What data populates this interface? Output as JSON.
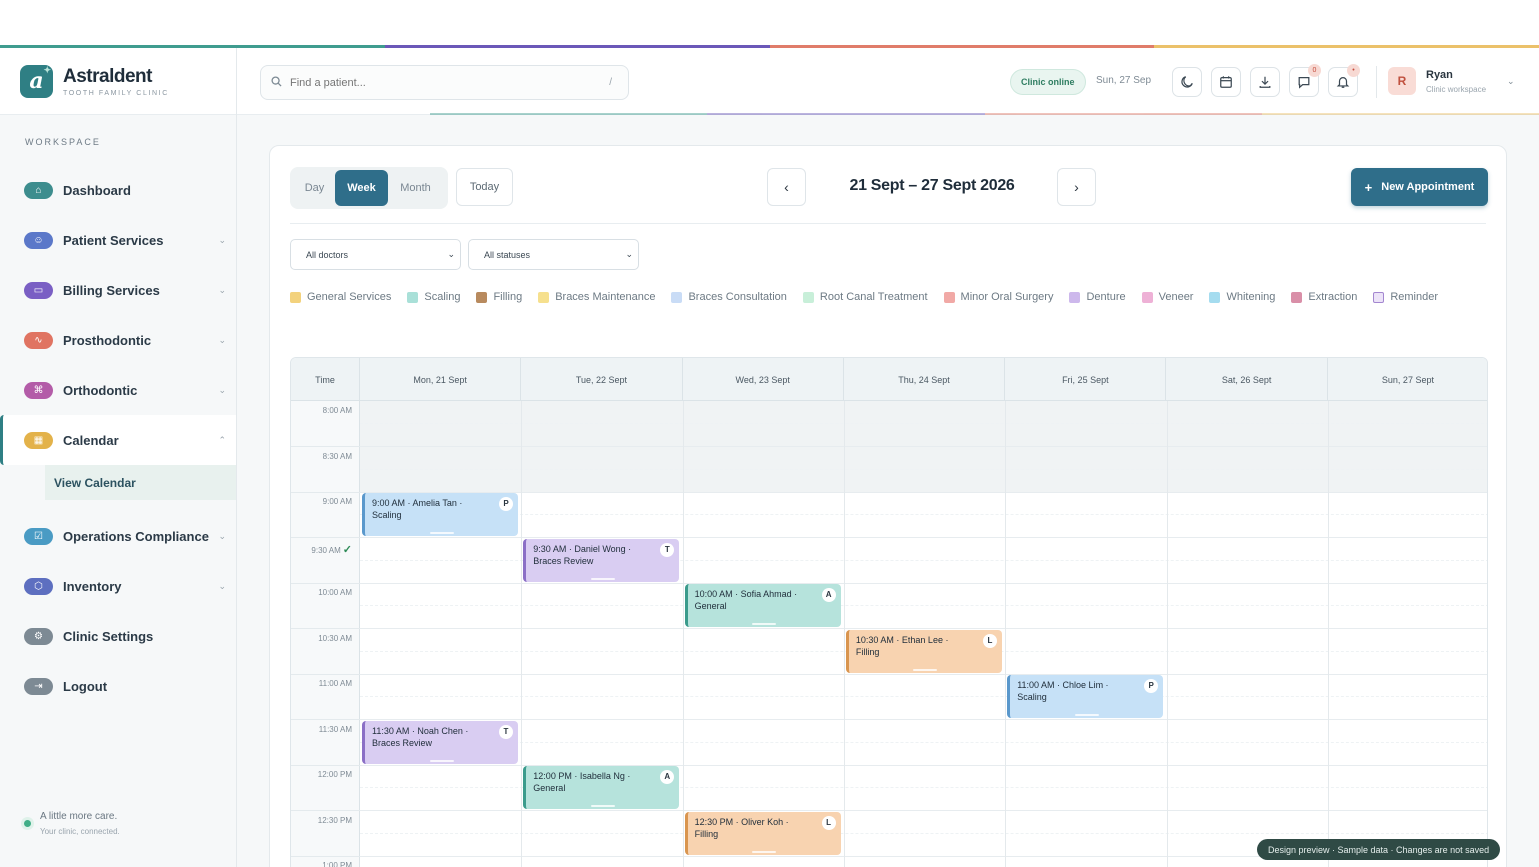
{
  "colors": {
    "accent": "#2f7f84",
    "primary": "#2f6e8a",
    "rainbow": [
      "#3f9c8f",
      "#6b58b8",
      "#e07c6a",
      "#ebc16a"
    ]
  },
  "brand": {
    "logo_letter": "a",
    "name": "Astraldent",
    "subtitle": "TOOTH FAMILY CLINIC"
  },
  "sidebar": {
    "section": "WORKSPACE",
    "items": [
      {
        "label": "Dashboard",
        "icon": "home-icon",
        "color": "#3d8d8e",
        "glyph": "⌂",
        "chevron": ""
      },
      {
        "label": "Patient Services",
        "icon": "users-icon",
        "color": "#5b78c9",
        "glyph": "☺",
        "chevron": "⌄"
      },
      {
        "label": "Billing Services",
        "icon": "card-icon",
        "color": "#7a5fc4",
        "glyph": "▭",
        "chevron": "⌄"
      },
      {
        "label": "Prosthodontic",
        "icon": "pulse-icon",
        "color": "#e07462",
        "glyph": "∿",
        "chevron": "⌄"
      },
      {
        "label": "Orthodontic",
        "icon": "command-icon",
        "color": "#b35ca8",
        "glyph": "⌘",
        "chevron": "⌄"
      },
      {
        "label": "Calendar",
        "icon": "calendar-icon",
        "color": "#e3b24a",
        "glyph": "▦",
        "chevron": "⌃"
      }
    ],
    "sub_item": "View Calendar",
    "items2": [
      {
        "label": "Operations Compliance",
        "icon": "checkbox-icon",
        "color": "#4a9bc4",
        "glyph": "☑",
        "chevron": "⌄"
      },
      {
        "label": "Inventory",
        "icon": "box-icon",
        "color": "#5d6fc0",
        "glyph": "⬡",
        "chevron": "⌄"
      },
      {
        "label": "Clinic Settings",
        "icon": "gear-icon",
        "color": "#7d8a94",
        "glyph": "⚙",
        "chevron": ""
      },
      {
        "label": "Logout",
        "icon": "logout-icon",
        "color": "#7d8a94",
        "glyph": "⇥",
        "chevron": ""
      }
    ],
    "footer": {
      "line1": "A little more care.",
      "line2": "Your clinic, connected."
    }
  },
  "header": {
    "search_placeholder": "Find a patient...",
    "search_shortcut": "/",
    "status": "Clinic online",
    "date": "Sun, 27 Sep",
    "messages_badge": "0",
    "notifications_badge": "•",
    "user": {
      "initial": "R",
      "name": "Ryan",
      "role": "Clinic workspace"
    }
  },
  "toolbar": {
    "views": [
      "Day",
      "Week",
      "Month"
    ],
    "active_view": "Week",
    "today": "Today",
    "range": "21 Sept – 27 Sept 2026",
    "new": "New Appointment"
  },
  "filters": {
    "doctors": "All doctors",
    "statuses": "All statuses"
  },
  "legend": [
    {
      "label": "General Services",
      "color": "#f3d27d"
    },
    {
      "label": "Scaling",
      "color": "#a9e0d8"
    },
    {
      "label": "Filling",
      "color": "#b88a5e"
    },
    {
      "label": "Braces Maintenance",
      "color": "#f6e08e"
    },
    {
      "label": "Braces Consultation",
      "color": "#c9dcf6"
    },
    {
      "label": "Root Canal Treatment",
      "color": "#c8efd9"
    },
    {
      "label": "Minor Oral Surgery",
      "color": "#f1a9a6"
    },
    {
      "label": "Denture",
      "color": "#cdb8ec"
    },
    {
      "label": "Veneer",
      "color": "#eeb1d6"
    },
    {
      "label": "Whitening",
      "color": "#a5dcef"
    },
    {
      "label": "Extraction",
      "color": "#d98fa8"
    },
    {
      "label": "Reminder",
      "color": "#ece3f8",
      "border": "#a386d0"
    }
  ],
  "calendar": {
    "time_header": "Time",
    "days": [
      "Mon, 21 Sept",
      "Tue, 22 Sept",
      "Wed, 23 Sept",
      "Thu, 24 Sept",
      "Fri, 25 Sept",
      "Sat, 26 Sept",
      "Sun, 27 Sept"
    ],
    "times": [
      "8:00 AM",
      "8:30 AM",
      "9:00 AM",
      "9:30 AM",
      "10:00 AM",
      "10:30 AM",
      "11:00 AM",
      "11:30 AM",
      "12:00 PM",
      "12:30 PM",
      "1:00 PM"
    ],
    "past_slots": 2,
    "current_time": "9:30 AM",
    "appointments": [
      {
        "day": 0,
        "slot": 2,
        "line1": "9:00 AM · Amelia Tan ·",
        "line2": "Scaling",
        "doctor": "P",
        "color": "blue"
      },
      {
        "day": 1,
        "slot": 3,
        "line1": "9:30 AM · Daniel Wong ·",
        "line2": "Braces Review",
        "doctor": "T",
        "color": "purple"
      },
      {
        "day": 2,
        "slot": 4,
        "line1": "10:00 AM · Sofia Ahmad ·",
        "line2": "General",
        "doctor": "A",
        "color": "teal"
      },
      {
        "day": 3,
        "slot": 5,
        "line1": "10:30 AM · Ethan Lee ·",
        "line2": "Filling",
        "doctor": "L",
        "color": "orange"
      },
      {
        "day": 4,
        "slot": 6,
        "line1": "11:00 AM · Chloe Lim ·",
        "line2": "Scaling",
        "doctor": "P",
        "color": "blue"
      },
      {
        "day": 0,
        "slot": 7,
        "line1": "11:30 AM · Noah Chen ·",
        "line2": "Braces Review",
        "doctor": "T",
        "color": "purple"
      },
      {
        "day": 1,
        "slot": 8,
        "line1": "12:00 PM · Isabella Ng ·",
        "line2": "General",
        "doctor": "A",
        "color": "teal"
      },
      {
        "day": 2,
        "slot": 9,
        "line1": "12:30 PM · Oliver Koh ·",
        "line2": "Filling",
        "doctor": "L",
        "color": "orange"
      }
    ]
  },
  "preview_note": "Design preview · Sample data · Changes are not saved"
}
